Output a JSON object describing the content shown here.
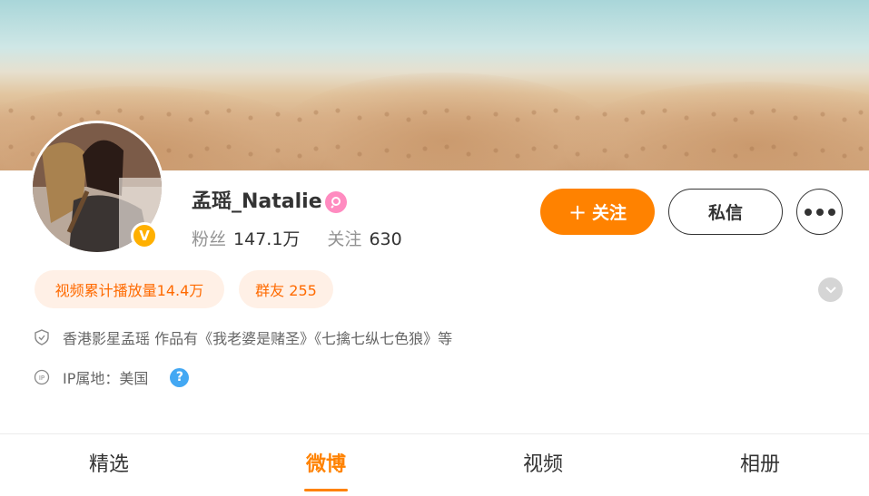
{
  "profile": {
    "name": "孟瑶_Natalie",
    "followers_label": "粉丝",
    "followers_value": "147.1万",
    "following_label": "关注",
    "following_value": "630",
    "verified_mark": "V"
  },
  "actions": {
    "follow_plus": "+",
    "follow_label": "关注",
    "message_label": "私信"
  },
  "tags": {
    "video_plays": "视频累计播放量14.4万",
    "group_friends": "群友 255"
  },
  "info": {
    "bio": "香港影星孟瑶 作品有《我老婆是赌圣》《七擒七纵七色狼》等",
    "ip_location": "IP属地：美国",
    "help_mark": "?"
  },
  "tabs": [
    {
      "label": "精选",
      "active": false
    },
    {
      "label": "微博",
      "active": true
    },
    {
      "label": "视频",
      "active": false
    },
    {
      "label": "相册",
      "active": false
    }
  ],
  "colors": {
    "accent": "#ff8200",
    "tag_bg": "#fff0e6",
    "tag_text": "#ff6a00",
    "verified": "#ffb000",
    "help": "#43a8f3"
  }
}
